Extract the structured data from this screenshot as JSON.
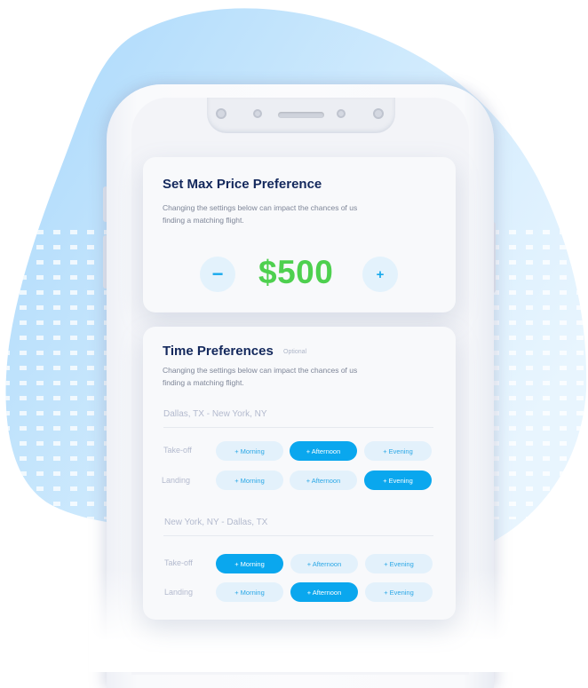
{
  "colors": {
    "accent": "#0aa7ee",
    "accent_light": "#e3f1fb",
    "price_green": "#4ed04f",
    "title_navy": "#13285c",
    "blob_blue": "#bfe3fb"
  },
  "price_card": {
    "title": "Set Max Price Preference",
    "description": "Changing the settings below can impact the chances of us finding a matching flight.",
    "decrease_label": "−",
    "increase_label": "+",
    "price": "$500"
  },
  "time_card": {
    "title": "Time Preferences",
    "optional_label": "Optional",
    "description": "Changing the settings below can impact the chances of us finding a matching flight.",
    "routes": [
      {
        "name": "Dallas, TX - New York, NY",
        "rows": [
          {
            "label": "Take-off",
            "options": [
              "+ Morning",
              "+ Afternoon",
              "+ Evening"
            ],
            "selected": "+ Afternoon"
          },
          {
            "label": "Landing",
            "options": [
              "+ Morning",
              "+ Afternoon",
              "+ Evening"
            ],
            "selected": "+ Evening"
          }
        ]
      },
      {
        "name": "New York, NY - Dallas, TX",
        "rows": [
          {
            "label": "Take-off",
            "options": [
              "+ Morning",
              "+ Afternoon",
              "+ Evening"
            ],
            "selected": "+ Morning"
          },
          {
            "label": "Landing",
            "options": [
              "+ Morning",
              "+ Afternoon",
              "+ Evening"
            ],
            "selected": "+ Afternoon"
          }
        ]
      }
    ]
  }
}
